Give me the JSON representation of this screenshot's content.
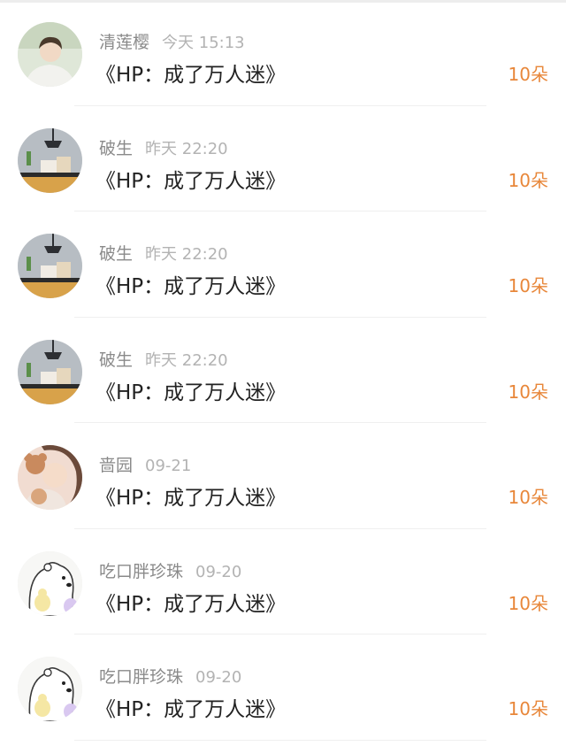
{
  "feed": {
    "items": [
      {
        "user": "清莲樱",
        "time": "今天 15:13",
        "title": "《HP：成了万人迷》",
        "gift": "10朵",
        "avatar_icon": "boy-portrait-avatar"
      },
      {
        "user": "破生",
        "time": "昨天 22:20",
        "title": "《HP：成了万人迷》",
        "gift": "10朵",
        "avatar_icon": "room-lamp-avatar"
      },
      {
        "user": "破生",
        "time": "昨天 22:20",
        "title": "《HP：成了万人迷》",
        "gift": "10朵",
        "avatar_icon": "room-lamp-avatar"
      },
      {
        "user": "破生",
        "time": "昨天 22:20",
        "title": "《HP：成了万人迷》",
        "gift": "10朵",
        "avatar_icon": "room-lamp-avatar"
      },
      {
        "user": "啬园",
        "time": "09-21",
        "title": "《HP：成了万人迷》",
        "gift": "10朵",
        "avatar_icon": "girl-teddy-avatar"
      },
      {
        "user": "吃口胖珍珠",
        "time": "09-20",
        "title": "《HP：成了万人迷》",
        "gift": "10朵",
        "avatar_icon": "polar-bear-cartoon-avatar"
      },
      {
        "user": "吃口胖珍珠",
        "time": "09-20",
        "title": "《HP：成了万人迷》",
        "gift": "10朵",
        "avatar_icon": "polar-bear-cartoon-avatar"
      }
    ]
  },
  "colors": {
    "gift_accent": "#e8873a",
    "username": "#8a8a8a",
    "timestamp": "#b3b3b3",
    "title": "#222222"
  }
}
